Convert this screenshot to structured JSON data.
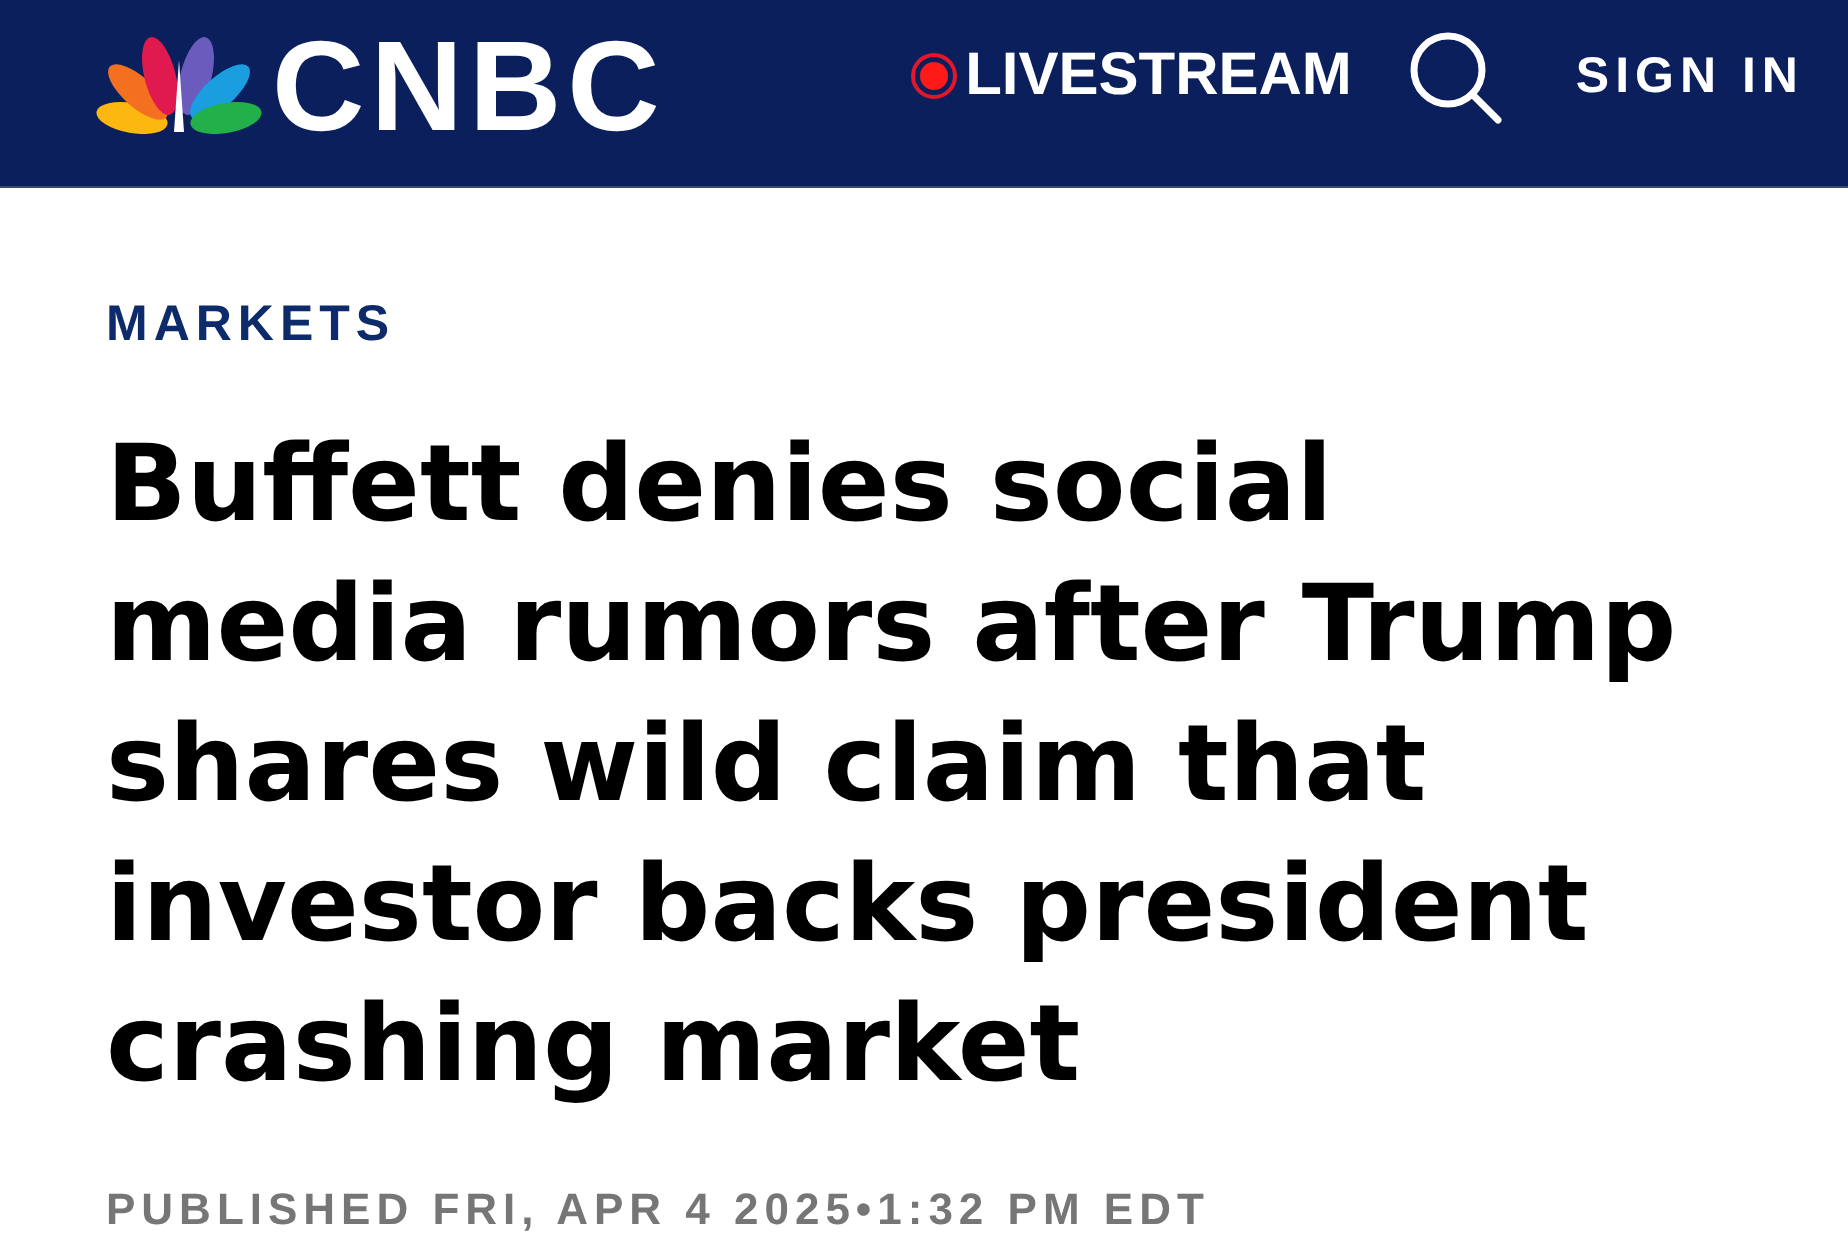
{
  "header": {
    "logo_text": "CNBC",
    "livestream": "LIVESTREAM",
    "sign_in": "SIGN IN"
  },
  "article": {
    "section": "MARKETS",
    "headline": "Buffett denies social media rumors after Trump shares wild claim that investor backs president crashing market",
    "published": "PUBLISHED FRI, APR 4 2025•1:32 PM EDT"
  }
}
